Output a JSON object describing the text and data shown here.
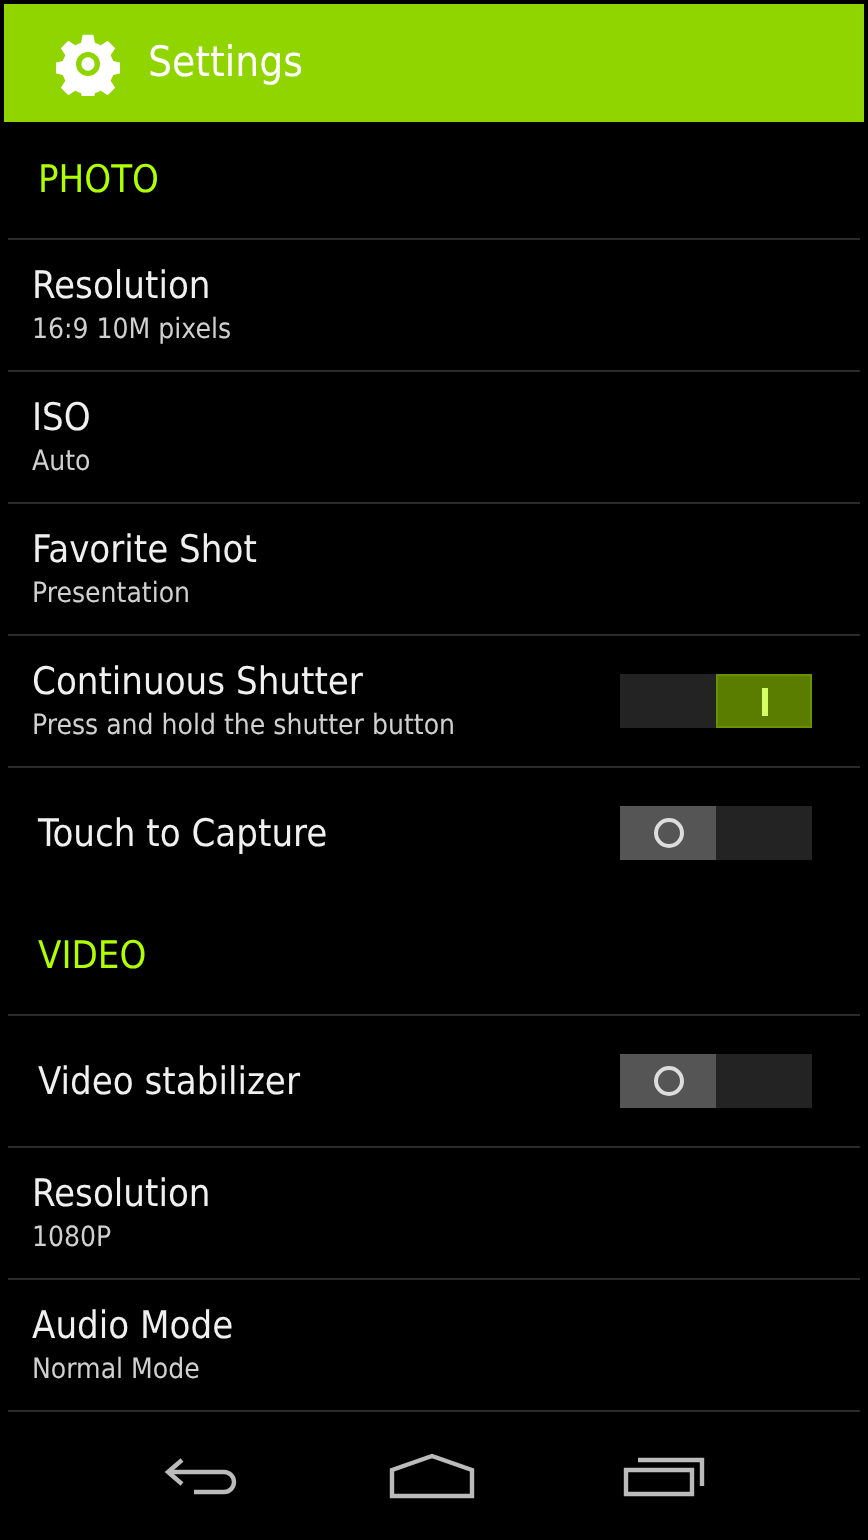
{
  "header": {
    "title": "Settings"
  },
  "sections": [
    {
      "title": "PHOTO",
      "items": [
        {
          "kind": "value",
          "title": "Resolution",
          "subtitle": "16:9 10M pixels"
        },
        {
          "kind": "value",
          "title": "ISO",
          "subtitle": "Auto"
        },
        {
          "kind": "value",
          "title": "Favorite Shot",
          "subtitle": "Presentation"
        },
        {
          "kind": "toggle",
          "title": "Continuous Shutter",
          "subtitle": "Press and hold the shutter button",
          "on": true
        },
        {
          "kind": "toggle",
          "title": "Touch to Capture",
          "on": false
        }
      ]
    },
    {
      "title": "VIDEO",
      "items": [
        {
          "kind": "toggle",
          "title": "Video stabilizer",
          "on": false
        },
        {
          "kind": "value",
          "title": "Resolution",
          "subtitle": "1080P"
        },
        {
          "kind": "value",
          "title": "Audio Mode",
          "subtitle": "Normal Mode"
        }
      ]
    }
  ]
}
